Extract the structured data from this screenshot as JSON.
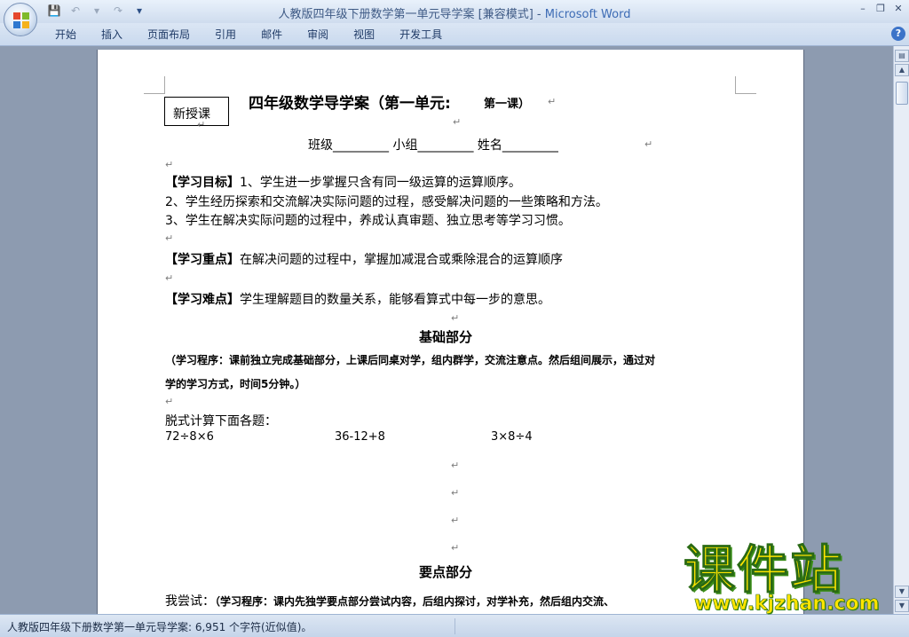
{
  "window": {
    "title": "人教版四年级下册数学第一单元导学案 [兼容模式]",
    "title_sep": " - ",
    "app_name": "Microsoft Word",
    "controls": [
      "–",
      "❐",
      "✕"
    ]
  },
  "quick_access": {
    "save_icon": "💾",
    "undo_icon": "↶",
    "undo_drop": "▾",
    "redo_icon": "↷",
    "customize_icon": "▾"
  },
  "ribbon": {
    "tabs": [
      "开始",
      "插入",
      "页面布局",
      "引用",
      "邮件",
      "审阅",
      "视图",
      "开发工具"
    ],
    "help": "?"
  },
  "doc": {
    "tag_box": "新授课",
    "heading_main": "四年级数学导学案（第一单元:",
    "heading_sub": "第一课）",
    "class_line": "班级_________      小组_________      姓名_________",
    "goal_label": "【学习目标】",
    "goal_1": "1、学生进一步掌握只含有同一级运算的运算顺序。",
    "goal_2": "2、学生经历探索和交流解决实际问题的过程，感受解决问题的一些策略和方法。",
    "goal_3": "3、学生在解决实际问题的过程中，养成认真审题、独立思考等学习习惯。",
    "key_label": "【学习重点】",
    "key_text": "在解决问题的过程中，掌握加减混合或乘除混合的运算顺序",
    "diff_label": "【学习难点】",
    "diff_text": "学生理解题目的数量关系，能够看算式中每一步的意思。",
    "section_basic": "基础部分",
    "procedure_1a": "（学习程序：课前独立完成基础部分，上课后同桌对学，组内群学，交流注意点。然后组间展示，通过对",
    "procedure_1b": "学的学习方式，时间5分钟。）",
    "calc_title": "脱式计算下面各题：",
    "calc_1": "72÷8×6",
    "calc_2": "36-12+8",
    "calc_3": "3×8÷4",
    "section_key": "要点部分",
    "try_label": "我尝试：",
    "try_text": "（学习程序：课内先独学要点部分尝试内容，后组内探讨，对学补充，然后组内交流、",
    "para_mark": "↵"
  },
  "status": {
    "text": "人教版四年级下册数学第一单元导学案: 6,951 个字符(近似值)。"
  },
  "watermark": {
    "main": "课件站",
    "sub": "www.kjzhan.com"
  }
}
